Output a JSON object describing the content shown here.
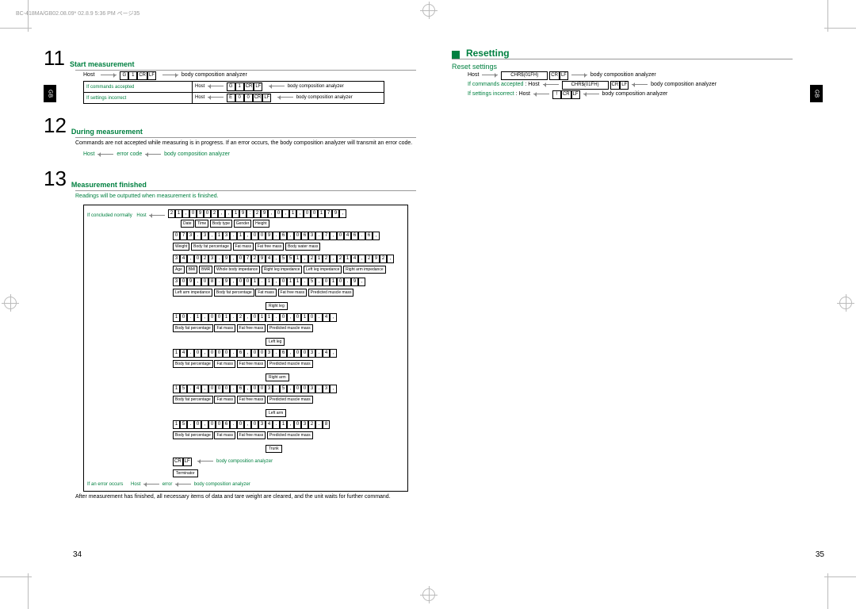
{
  "header": "BC-418MA/GB02.08.09* 02.8.9 5:36 PM  ページ35",
  "sideTab": "GB",
  "page": {
    "left": "34",
    "right": "35"
  },
  "s11": {
    "num": "11",
    "title": "Start measurement",
    "hostLabel": "Host",
    "cmd": [
      "G",
      "1",
      "CR",
      "LF"
    ],
    "bca": "body composition analyzer",
    "r1_label": "If commands accepted",
    "r1_host": "Host",
    "r1_cmd": [
      "G",
      "1",
      "CR",
      "LF"
    ],
    "r2_label": "If settings incorrect",
    "r2_host": "Host",
    "r2_cmd": [
      "E",
      "0",
      "0",
      "CR",
      "LF"
    ]
  },
  "s12": {
    "num": "12",
    "title": "During measurement",
    "text1": "Commands are not accepted while measuring is in progress. If an error occurs, the body composition analyzer will transmit an error code.",
    "line2_host": "Host",
    "line2_err": "error code",
    "line2_bca": "body composition analyzer"
  },
  "s13": {
    "num": "13",
    "title": "Measurement finished",
    "intro": "Readings will be outputted when measurement is finished.",
    "if_normal": "If concluded normally",
    "host": "Host",
    "row1": "21,0902,,19:29,0,1,00179,",
    "lbl1": [
      "Date",
      "Time",
      "Body type",
      "Gender",
      "Height"
    ],
    "row2": "073.3,13.1,009.6,063.7,046.6,",
    "lbl2": [
      "Weight",
      "Body fat percentage",
      "Fat mass",
      "Fat free mass",
      "Body water mass"
    ],
    "row3": "34,023.9,07294,551,212,214,292,",
    "lbl3": [
      "Age",
      "BMI",
      "BMR",
      "Whole body impedance",
      "Right leg impedance",
      "Left leg impedance",
      "Right arm impedance"
    ],
    "row4": "309,08.9,001.1,011.5,010.9,",
    "lbl4": [
      "Left arm impedance",
      "Body fat percentage",
      "Fat mass",
      "Fat free mass",
      "Predicted muscle mass"
    ],
    "segA": "Right leg",
    "row5": "10.1,001.2,011.0,010.4,",
    "lbl5": [
      "Body fat percentage",
      "Fat mass",
      "Fat free mass",
      "Predicted muscle mass"
    ],
    "segB": "Left leg",
    "row6": "14.0,000.6,003.6,003.4,",
    "lbl6": [
      "Body fat percentage",
      "Fat mass",
      "Fat free mass",
      "Predicted muscle mass"
    ],
    "segC": "Right arm",
    "row7": "15.4,000.6,003.5,003.3,",
    "lbl7": [
      "Body fat percentage",
      "Fat mass",
      "Fat free mass",
      "Predicted muscle mass"
    ],
    "segD": "Left arm",
    "row8": "15.0,006.0,034.1,032.8",
    "lbl8": [
      "Body fat percentage",
      "Fat mass",
      "Fat free mass",
      "Predicted muscle mass"
    ],
    "segE": "Trunk",
    "term": [
      "CR",
      "LF"
    ],
    "termLabel": "Terminator",
    "bca": "body composition analyzer",
    "if_err": "If an error occurs",
    "err_host": "Host",
    "err_txt": "error",
    "outro": "After measurement has finished, all necessary items of data and tare weight are cleared, and the unit waits for further command."
  },
  "reset": {
    "title": "Resetting",
    "subtitle": "Reset settings",
    "hostLabel": "Host",
    "cmd1_pre": "CHR$(01FH)",
    "cmd1": [
      "CR",
      "LF"
    ],
    "bca": "body composition analyzer",
    "r1_label": "If commands accepted",
    "r1_host": ": Host",
    "r1_pre": "CHR$(01FH)",
    "r1_cmd": [
      "CR",
      "LF"
    ],
    "r2_label": "If settings incorrect",
    "r2_host": ": Host",
    "r2_cmd": [
      "!",
      "CR",
      "LF"
    ]
  }
}
